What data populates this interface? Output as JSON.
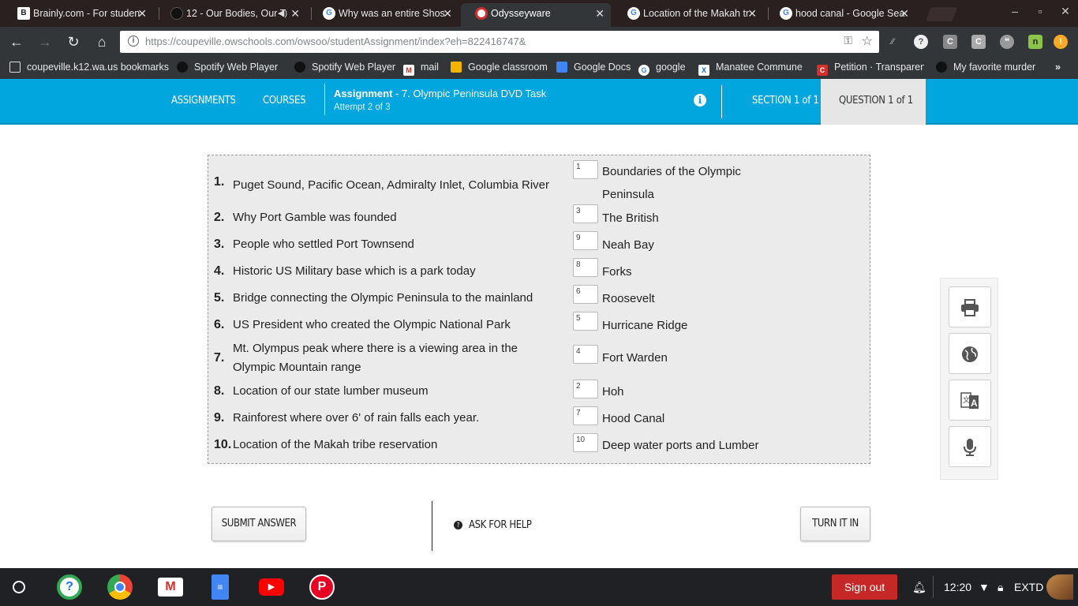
{
  "browser": {
    "tabs": [
      {
        "title": "Brainly.com - For studen",
        "icon": "brainly-icon",
        "active": false
      },
      {
        "title": "12 - Our Bodies, Our T",
        "icon": "spotify-icon",
        "active": false
      },
      {
        "title": "Why was an entire Shos",
        "icon": "google-icon",
        "active": false
      },
      {
        "title": "Odysseyware",
        "icon": "odysseyware-icon",
        "active": true
      },
      {
        "title": "Location of the Makah tr",
        "icon": "google-icon",
        "active": false
      },
      {
        "title": "hood canal - Google Sea",
        "icon": "google-icon",
        "active": false
      }
    ],
    "url_host": "https://coupeville.owschools.com",
    "url_path": "/owsoo/studentAssignment/index?eh=822416747&",
    "bookmarks": [
      "coupeville.k12.wa.us bookmarks",
      "Spotify Web Player -",
      "Spotify Web Player",
      "mail",
      "Google classroom",
      "Google Docs",
      "google",
      "Manatee Commune",
      "Petition · Transparen",
      "My favorite murder"
    ],
    "overflow": "»"
  },
  "header": {
    "assignments": "ASSIGNMENTS",
    "courses": "COURSES",
    "assignment_label": "Assignment",
    "assignment_name": " - 7. Olympic Peninsula DVD Task",
    "attempt": "Attempt 2 of 3",
    "section": "SECTION 1 of 1",
    "question": "QUESTION 1 of 1",
    "accent": "#00a6dd"
  },
  "matching": {
    "items": [
      {
        "num": "1.",
        "question": "Puget Sound, Pacific Ocean, Admiralty Inlet, Columbia River",
        "answer": "1",
        "option": "Boundaries of the Olympic Peninsula"
      },
      {
        "num": "2.",
        "question": "Why Port Gamble was founded",
        "answer": "3",
        "option": "The British"
      },
      {
        "num": "3.",
        "question": "People who settled Port Townsend",
        "answer": "9",
        "option": "Neah Bay"
      },
      {
        "num": "4.",
        "question": "Historic US Military base which is a park today",
        "answer": "8",
        "option": "Forks"
      },
      {
        "num": "5.",
        "question": "Bridge connecting the Olympic Peninsula to the mainland",
        "answer": "6",
        "option": "Roosevelt"
      },
      {
        "num": "6.",
        "question": "US President who created the Olympic National Park",
        "answer": "5",
        "option": "Hurricane Ridge"
      },
      {
        "num": "7.",
        "question": "Mt. Olympus peak where there is a viewing area in the Olympic Mountain range",
        "answer": "4",
        "option": "Fort Warden"
      },
      {
        "num": "8.",
        "question": "Location of our state lumber museum",
        "answer": "2",
        "option": "Hoh"
      },
      {
        "num": "9.",
        "question": "Rainforest where over 6' of rain falls each year.",
        "answer": "7",
        "option": "Hood Canal"
      },
      {
        "num": "10.",
        "question": "Location of the Makah tribe reservation",
        "answer": "10",
        "option": "Deep water ports and Lumber"
      }
    ]
  },
  "tools": [
    "printer-icon",
    "globe-icon",
    "translate-icon",
    "microphone-icon"
  ],
  "actions": {
    "submit": "SUBMIT ANSWER",
    "help": "ASK FOR HELP",
    "turn_in": "TURN IT IN"
  },
  "shelf": {
    "sign_out": "Sign out",
    "time": "12:20",
    "keyboard": "EXTD"
  }
}
